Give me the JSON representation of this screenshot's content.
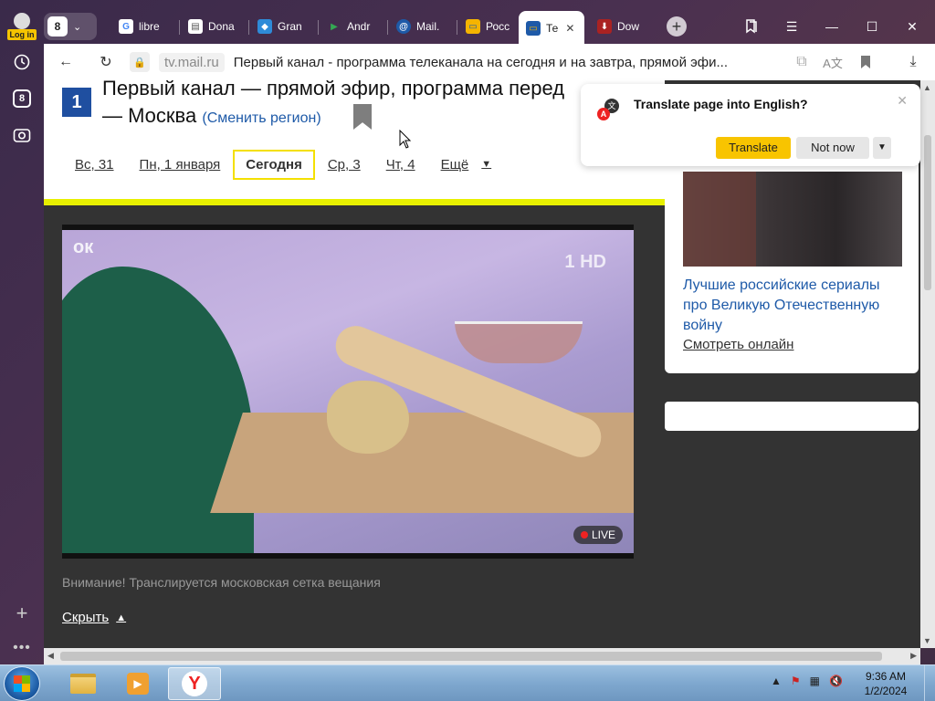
{
  "rail": {
    "login_label": "Log in",
    "tab_counter": "8",
    "icons": [
      "clock-icon",
      "collections-icon",
      "screenshot-icon",
      "add-icon",
      "more-icon"
    ]
  },
  "tabs": {
    "count": "8",
    "items": [
      {
        "label": "libre",
        "icon": "google-icon"
      },
      {
        "label": "Dona",
        "icon": "document-icon"
      },
      {
        "label": "Gran",
        "icon": "app-icon"
      },
      {
        "label": "Andr",
        "icon": "play-icon"
      },
      {
        "label": "Mail.",
        "icon": "mail-icon"
      },
      {
        "label": "Росс",
        "icon": "tv-icon"
      },
      {
        "label": "Те",
        "icon": "tv-icon",
        "active": true
      },
      {
        "label": "Dow",
        "icon": "download-icon"
      }
    ]
  },
  "addressbar": {
    "domain": "tv.mail.ru",
    "page_title": "Первый канал - программа телеканала на сегодня и на завтра, прямой эфи..."
  },
  "page": {
    "logo": "1",
    "title_line1": "Первый канал — прямой эфир, программа перед",
    "title_line2": "— Москва",
    "change_region": "(Сменить регион)",
    "days": [
      "Вс, 31",
      "Пн, 1 января",
      "Сегодня",
      "Ср, 3",
      "Чт, 4",
      "Ещё"
    ],
    "video": {
      "watermark": "ок",
      "channel_mark": "1 HD",
      "live_label": "LIVE"
    },
    "notice": "Внимание! Транслируется московская сетка вещания",
    "hide_link": "Скрыть"
  },
  "sidebar_card": {
    "headline": "Лучшие российские сериалы про Великую Отечественную войну",
    "watch_link": "Смотреть онлайн"
  },
  "translate_popup": {
    "question": "Translate page into English?",
    "translate_btn": "Translate",
    "not_now_btn": "Not now"
  },
  "taskbar": {
    "time": "9:36 AM",
    "date": "1/2/2024"
  },
  "colors": {
    "accent_yellow": "#f8c400",
    "link_blue": "#1e5aa8",
    "band_yellow": "#e8f000"
  }
}
